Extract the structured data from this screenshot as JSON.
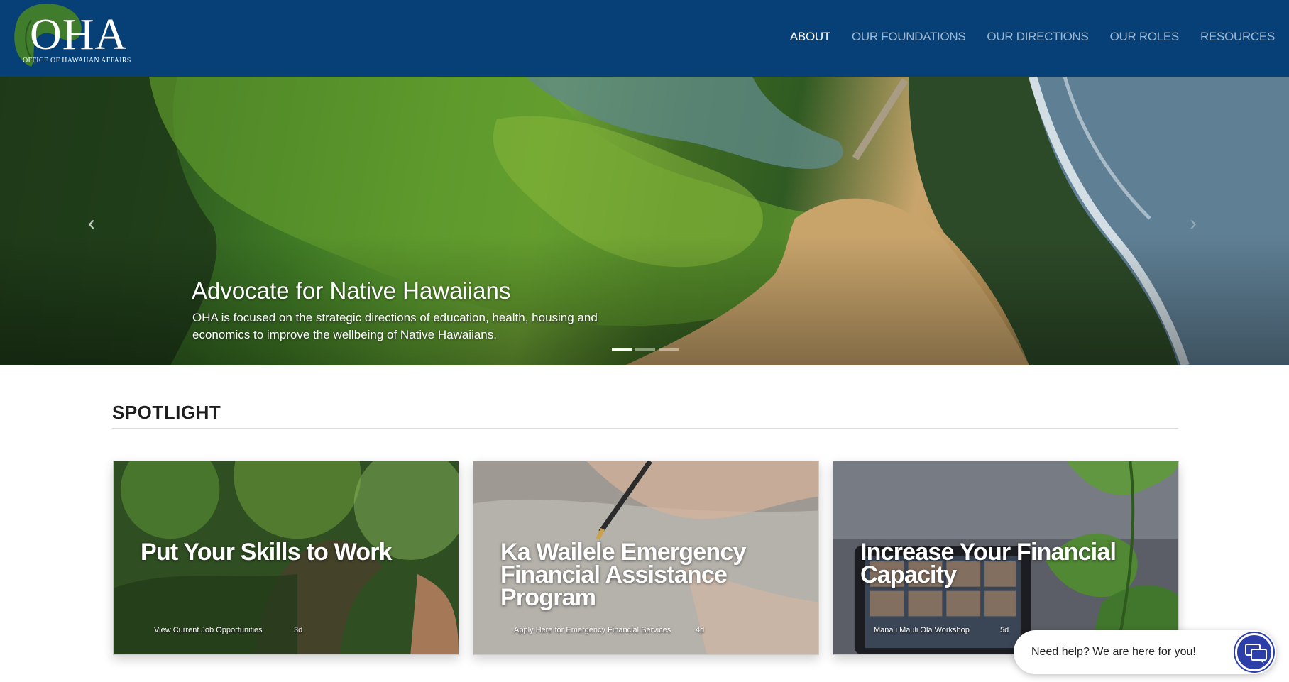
{
  "header": {
    "logo_text": "OHA",
    "logo_subtitle": "OFFICE OF HAWAIIAN AFFAIRS",
    "nav": [
      {
        "label": "ABOUT",
        "active": true
      },
      {
        "label": "OUR FOUNDATIONS",
        "active": false
      },
      {
        "label": "OUR DIRECTIONS",
        "active": false
      },
      {
        "label": "OUR ROLES",
        "active": false
      },
      {
        "label": "RESOURCES",
        "active": false
      }
    ]
  },
  "hero": {
    "title": "Advocate for Native Hawaiians",
    "text": "OHA is focused on the strategic directions of education, health, housing and economics to improve the wellbeing of Native Hawaiians.",
    "prev_icon": "chevron-left-icon",
    "next_icon": "chevron-right-icon",
    "slide_count": 3,
    "active_slide": 1
  },
  "spotlight": {
    "heading": "SPOTLIGHT",
    "cards": [
      {
        "title": "Put Your Skills to Work",
        "meta": "View Current Job Opportunities",
        "age": "3d"
      },
      {
        "title": "Ka Wailele Emergency Financial Assistance Program",
        "meta": "Apply Here for Emergency Financial Services",
        "age": "4d"
      },
      {
        "title": "Increase Your Financial Capacity",
        "meta": "Mana i Mauli Ola Workshop",
        "age": "5d"
      }
    ]
  },
  "chat": {
    "text": "Need help? We are here for you!",
    "icon": "chat-bubbles-icon"
  },
  "colors": {
    "header_bg": "#064077",
    "nav_inactive": "#9db8d3",
    "nav_active": "#ffffff",
    "chat_button": "#2d3ea8"
  }
}
